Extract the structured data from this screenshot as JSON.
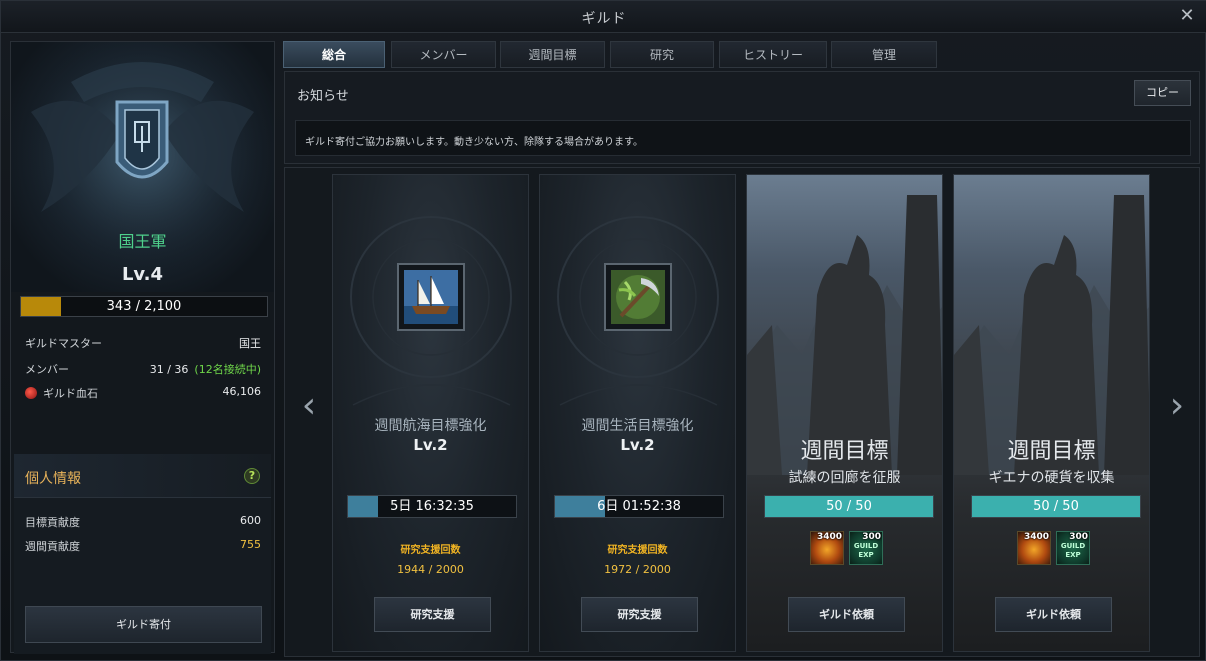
{
  "window": {
    "title": "ギルド",
    "close": "✕"
  },
  "guild": {
    "name": "国王軍",
    "level": "Lv.4",
    "exp_text": "343 / 2,100",
    "exp_fraction": 0.163,
    "rows": [
      {
        "label": "ギルドマスター",
        "value": "国王"
      },
      {
        "label": "メンバー",
        "value": "31 / 36",
        "extra": "(12名接続中)"
      },
      {
        "label": "ギルド血石",
        "value": "46,106"
      }
    ]
  },
  "personal": {
    "title": "個人情報",
    "help": "?",
    "rows": [
      {
        "label": "目標貢献度",
        "value": "600"
      },
      {
        "label": "週間貢献度",
        "value": "755"
      }
    ],
    "donate_label": "ギルド寄付"
  },
  "tabs": [
    "総合",
    "メンバー",
    "週間目標",
    "研究",
    "ヒストリー",
    "管理"
  ],
  "notice": {
    "title": "お知らせ",
    "copy_label": "コピー",
    "text": "ギルド寄付ご協力お願いします。動き少ない方、除隊する場合があります。"
  },
  "nav": {
    "prev": "‹",
    "next": "›"
  },
  "research_cards": [
    {
      "icon": "ship-icon",
      "name": "週間航海目標強化",
      "level": "Lv.2",
      "timer": "5日 16:32:35",
      "timer_fraction": 0.18,
      "support_label": "研究支援回数",
      "support_count": "1944 / 2000",
      "button": "研究支援"
    },
    {
      "icon": "pickaxe-icon",
      "name": "週間生活目標強化",
      "level": "Lv.2",
      "timer": "6日 01:52:38",
      "timer_fraction": 0.3,
      "support_label": "研究支援回数",
      "support_count": "1972 / 2000",
      "button": "研究支援"
    }
  ],
  "weekly_cards": [
    {
      "title": "週間目標",
      "subtitle": "試練の回廊を征服",
      "progress": "50 / 50",
      "progress_fraction": 1.0,
      "reward_amount": "3400",
      "exp_amount": "300",
      "exp_label_1": "GUILD",
      "exp_label_2": "EXP",
      "button": "ギルド依頼"
    },
    {
      "title": "週間目標",
      "subtitle": "ギエナの硬貨を収集",
      "progress": "50 / 50",
      "progress_fraction": 1.0,
      "reward_amount": "3400",
      "exp_amount": "300",
      "exp_label_1": "GUILD",
      "exp_label_2": "EXP",
      "button": "ギルド依頼"
    }
  ],
  "colors": {
    "guild_name": "#4fd18c",
    "online": "#6fd64a",
    "gold": "#f0c040",
    "exp_bar": "#b8890a",
    "timer_bar": "#3e7f9c",
    "goal_bar": "#3bb0ae"
  }
}
